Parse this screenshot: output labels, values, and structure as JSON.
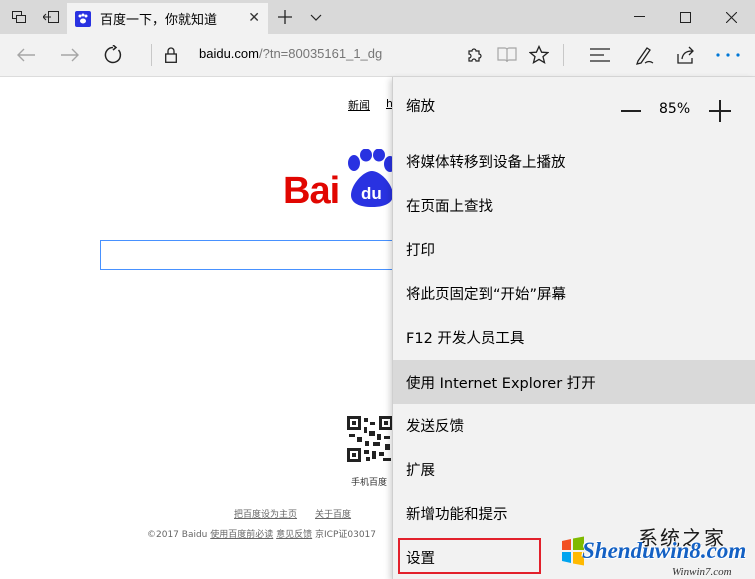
{
  "tab": {
    "title": "百度一下，你就知道"
  },
  "address": {
    "host": "baidu.com",
    "path": "/?tn=80035161_1_dg"
  },
  "page": {
    "nav_links": [
      "新闻",
      "h"
    ],
    "logo_text": "Bai",
    "logo_paw_text": "du",
    "qr_label": "手机百度",
    "footer_links": [
      "把百度设为主页",
      "关于百度"
    ],
    "footer_copyright": "©2017 Baidu ",
    "footer_terms": "使用百度前必读",
    "footer_feedback": "意见反馈",
    "footer_icp": " 京ICP证03017"
  },
  "menu": {
    "zoom_label": "缩放",
    "zoom_value": "85%",
    "items": [
      "将媒体转移到设备上播放",
      "在页面上查找",
      "打印",
      "将此页固定到“开始”屏幕",
      "F12 开发人员工具",
      "使用 Internet Explorer 打开",
      "发送反馈",
      "扩展",
      "新增功能和提示",
      "设置"
    ],
    "highlighted_item": "使用 Internet Explorer 打开",
    "outlined_item": "设置"
  },
  "watermark": {
    "top": "系统之家",
    "main": "Shenduwin8.com",
    "sub": "Winwin7.com"
  },
  "colors": {
    "tabbar": "#d9d9d9",
    "toolbar": "#f2f2f2",
    "accent": "#0078d7",
    "baidu_red": "#e10601",
    "baidu_blue": "#2932e1",
    "outline_red": "#e2202b"
  }
}
